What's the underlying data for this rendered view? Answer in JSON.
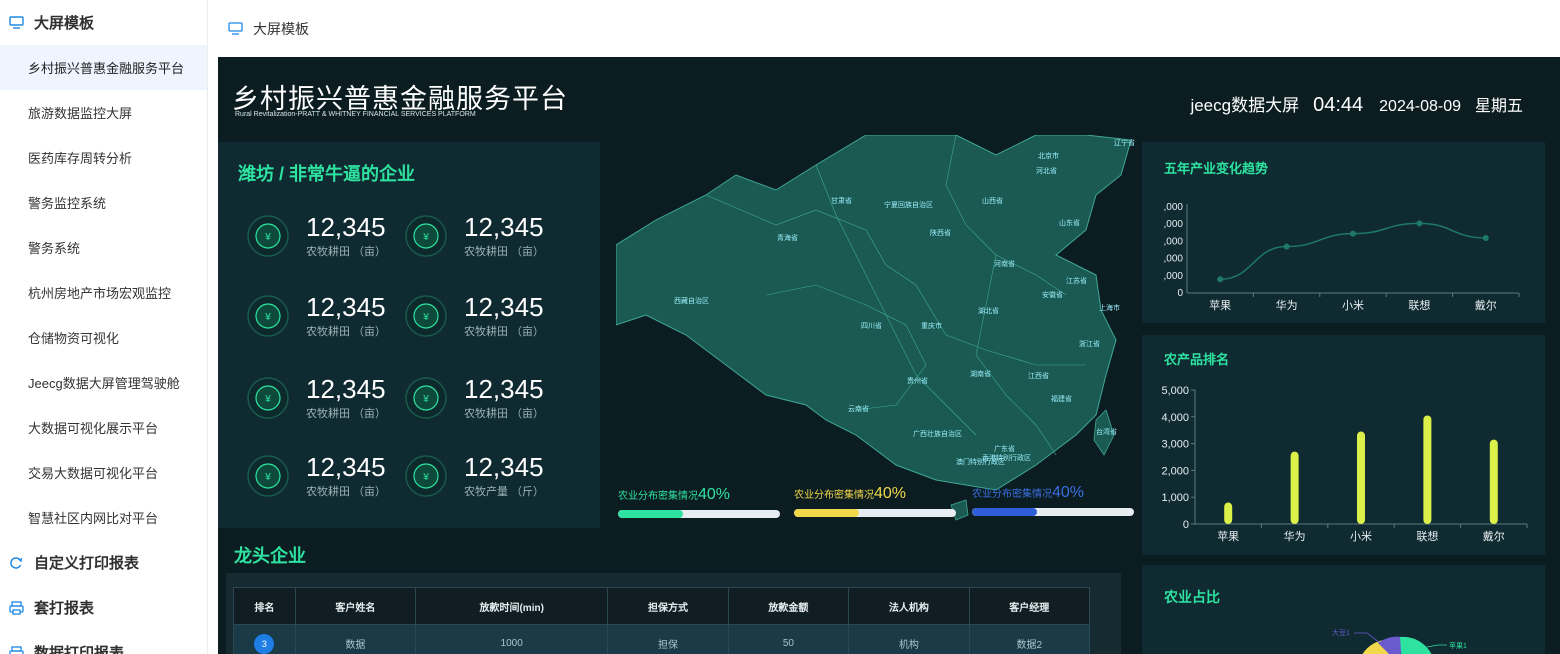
{
  "sidebar": {
    "group1": {
      "label": "大屏模板"
    },
    "items": [
      {
        "label": "乡村振兴普惠金融服务平台"
      },
      {
        "label": "旅游数据监控大屏"
      },
      {
        "label": "医药库存周转分析"
      },
      {
        "label": "警务监控系统"
      },
      {
        "label": "警务系统"
      },
      {
        "label": "杭州房地产市场宏观监控"
      },
      {
        "label": "仓储物资可视化"
      },
      {
        "label": "Jeecg数据大屏管理驾驶舱"
      },
      {
        "label": "大数据可视化展示平台"
      },
      {
        "label": "交易大数据可视化平台"
      },
      {
        "label": "智慧社区内网比对平台"
      }
    ],
    "group2": {
      "label": "自定义打印报表"
    },
    "group3": {
      "label": "套打报表"
    },
    "group4": {
      "label": "数据打印报表"
    }
  },
  "topbar": {
    "tab_label": "大屏模板"
  },
  "dashboard": {
    "title": "乡村振兴普惠金融服务平台",
    "subtitle": "Rural Revitalization-PRATT & WHITNEY FINANCIAL SERVICES PLATFORM",
    "brand": "jeecg数据大屏",
    "time": "04:44",
    "date": "2024-08-09",
    "weekday": "星期五",
    "stats_title": "潍坊 / 非常牛逼的企业",
    "stats": [
      {
        "value": "12,345",
        "label": "农牧耕田 （亩）"
      },
      {
        "value": "12,345",
        "label": "农牧耕田 （亩）"
      },
      {
        "value": "12,345",
        "label": "农牧耕田 （亩）"
      },
      {
        "value": "12,345",
        "label": "农牧耕田 （亩）"
      },
      {
        "value": "12,345",
        "label": "农牧耕田 （亩）"
      },
      {
        "value": "12,345",
        "label": "农牧耕田 （亩）"
      },
      {
        "value": "12,345",
        "label": "农牧耕田 （亩）"
      },
      {
        "value": "12,345",
        "label": "农牧产量 （斤）"
      }
    ],
    "map_labels": [
      "辽宁省",
      "北京市",
      "河北省",
      "甘肃省",
      "宁夏回族自治区",
      "山西省",
      "青海省",
      "陕西省",
      "山东省",
      "河南省",
      "江苏省",
      "西藏自治区",
      "安徽省",
      "上海市",
      "四川省",
      "重庆市",
      "湖北省",
      "浙江省",
      "湖南省",
      "江西省",
      "贵州省",
      "福建省",
      "云南省",
      "广西壮族自治区",
      "台湾省",
      "广东省",
      "香港特别行政区",
      "澳门特别行政区"
    ],
    "density_bars": [
      {
        "label": "农业分布密集情况",
        "pct": "40%",
        "fraction": 0.4,
        "color": "#2ee3a0",
        "text_color": "#2ee3a0"
      },
      {
        "label": "农业分布密集情况",
        "pct": "40%",
        "fraction": 0.4,
        "color": "#f2d84b",
        "text_color": "#f2d84b"
      },
      {
        "label": "农业分布密集情况",
        "pct": "40%",
        "fraction": 0.4,
        "color": "#2f5fd8",
        "text_color": "#3a6fe0"
      }
    ],
    "trend_title": "五年产业变化趋势",
    "rank_title": "农产品排名",
    "share_title": "农业占比",
    "share_labels": [
      "大豆1",
      "苹果1"
    ],
    "leaders_title": "龙头企业",
    "table": {
      "headers": [
        "排名",
        "客户姓名",
        "放款时间(min)",
        "担保方式",
        "放款金额",
        "法人机构",
        "客户经理"
      ],
      "rows": [
        {
          "rank": "3",
          "cells": [
            "数据",
            "1000",
            "担保",
            "50",
            "机构",
            "数据2"
          ]
        }
      ]
    }
  },
  "chart_data": [
    {
      "type": "line",
      "title": "五年产业变化趋势",
      "categories": [
        "苹果",
        "华为",
        "小米",
        "联想",
        "戴尔"
      ],
      "series": [
        {
          "values": [
            800,
            2700,
            3450,
            4050,
            3200
          ]
        }
      ],
      "y_tick_labels": [
        ",000",
        ",000",
        ",000",
        ",000",
        ",000",
        "0"
      ],
      "ylim": [
        0,
        5000
      ],
      "line_color": "#1e7a66"
    },
    {
      "type": "bar",
      "title": "农产品排名",
      "categories": [
        "苹果",
        "华为",
        "小米",
        "联想",
        "戴尔"
      ],
      "series": [
        {
          "values": [
            800,
            2700,
            3450,
            4050,
            3150
          ]
        }
      ],
      "y_tick_labels": [
        "5,000",
        "4,000",
        "3,000",
        "2,000",
        "1,000",
        "0"
      ],
      "ylim": [
        0,
        5000
      ],
      "bar_color": "#dcf04a"
    }
  ]
}
